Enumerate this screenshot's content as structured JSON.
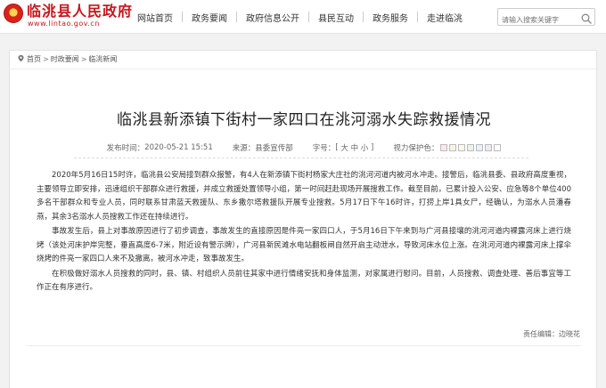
{
  "header": {
    "site_title": "临洮县人民政府",
    "site_url": "www.lintao.gov.cn",
    "nav": [
      "网站首页",
      "政务要闻",
      "政府信息公开",
      "县民互动",
      "政务服务",
      "走进临洮"
    ],
    "search_placeholder": "请输入搜索关键字"
  },
  "breadcrumb": {
    "home": "首页",
    "section": "时政要闻",
    "subsection": "临洮新闻"
  },
  "article": {
    "title": "临洮县新添镇下街村一家四口在洮河溺水失踪救援情况",
    "meta": {
      "published_label": "发布时间：",
      "published": "2020-05-21 15:51",
      "source_label": "来源：",
      "source": "县委宣传部",
      "fontsize_label": "字号：",
      "fontsize_open": "[",
      "size_large": "大",
      "size_medium": "中",
      "size_small": "小",
      "fontsize_close": "]",
      "color_label": "视力保护色：",
      "swatch_colors": [
        "#fae8eb",
        "#fbf2e1",
        "#fffbea",
        "#eaf5ea",
        "#e8f0fb",
        "#eeeaf6",
        "#ffffff"
      ]
    },
    "paragraphs": [
      "2020年5月16日15时许，临洮县公安局接到群众报警，有4人在新添镇下街村杨家大庄社的洮河河道内被河水冲走。接警后，临洮县委、县政府高度重视，主要领导立即安排，迅速组织干部群众进行救援，并成立救援处置领导小组，第一时间赶赴现场开展搜救工作。截至目前，已累计投入公安、应急等8个单位400多名干部群众和专业人员，同时联系甘肃蓝天救援队、东乡撒尔塔救援队开展专业搜救。5月17日下午16时许，打捞上岸1具女尸，经确认，为溺水人员潘春燕，其余3名溺水人员搜救工作还在持续进行。",
      "事故发生后，县上对事故原因进行了初步调查，事故发生的直接原因是件亮一家四口人，于5月16日下午来到与广河县接壤的洮河河道内裸露河床上进行烧烤（该处河床护岸完整，垂直高度6-7米，附近设有警示牌），广河县新民滩水电站翻板闸自然开启主动泄水，导致河床水位上涨。在洮河河道内裸露河床上撑伞烧烤的件亮一家四口人来不及撤离，被河水冲走，致事故发生。",
      "在积极做好溺水人员搜救的同时，县、镇、村组织人员前往其家中进行情绪安抚和身体监测，对家属进行慰问。目前，人员搜救、调查处理、善后事宜等工作正在有序进行。"
    ],
    "editor_label": "责任编辑：",
    "editor": "边晓花"
  }
}
